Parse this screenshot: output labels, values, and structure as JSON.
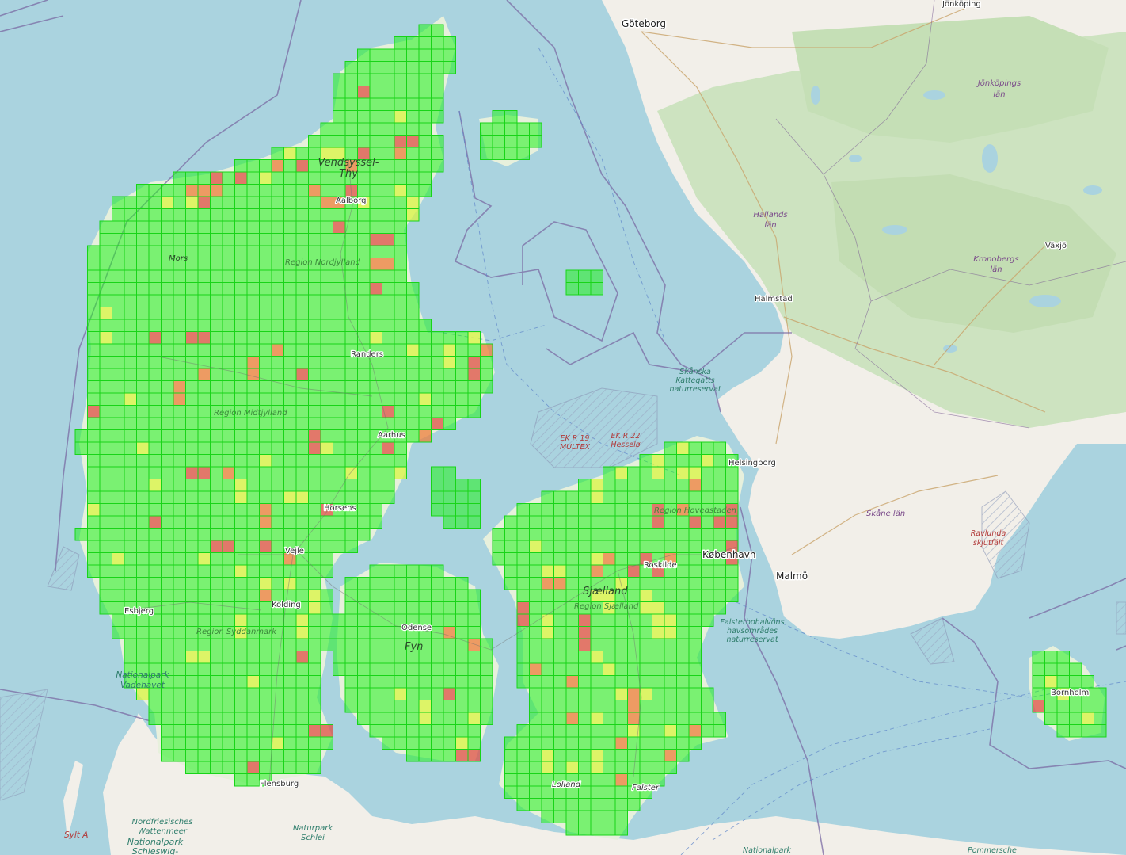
{
  "map": {
    "grid_colors": {
      "low": "#21f21b",
      "medium": "#d9f53a",
      "high": "#f07a35",
      "very_high": "#e04a3e",
      "grid_line": "#18d418"
    },
    "base_colors": {
      "sea": "#aad3df",
      "land": "#f2efe9",
      "forest": "#cde3c0",
      "border": "#7a5b93"
    }
  },
  "labels": {
    "goteborg": "Göteborg",
    "jonkoping": "Jönköping",
    "jonkopings_lan": "Jönköpings län",
    "hallands_lan": "Hallands län",
    "kronobergs_lan": "Kronobergs län",
    "vaxjo": "Växjö",
    "halmstad": "Halmstad",
    "skanska_kattegatts": "Skånska Kattegatts naturreservat",
    "ek_r19": "EK R 19 MULTEX",
    "ek_r22": "EK R 22 Hesselø",
    "helsingborg": "Helsingborg",
    "region_hovedstaden": "Region Hovedstaden",
    "kobenhavn": "København",
    "malmo": "Malmö",
    "skane_lan": "Skåne län",
    "ravlunda": "Ravlunda skjutfält",
    "falsterbohalvons": "Falsterbohalvöns havsområdes naturreservat",
    "bornholm": "Bornholm",
    "vendsyssel": "Vendsyssel-Thy",
    "aalborg": "Aalborg",
    "mors": "Mors",
    "region_nordjylland": "Region Nordjylland",
    "randers": "Randers",
    "region_midtjylland": "Region Midtjylland",
    "aarhus": "Aarhus",
    "horsens": "Horsens",
    "vejle": "Vejle",
    "kolding": "Kolding",
    "esbjerg": "Esbjerg",
    "region_syddanmark": "Region Syddanmark",
    "nationalpark_vadehavet": "Nationalpark Vadehavet",
    "odense": "Odense",
    "fyn": "Fyn",
    "sjaelland": "Sjælland",
    "region_sjaelland": "Region Sjælland",
    "roskilde": "Roskilde",
    "lolland": "Lolland",
    "falster": "Falster",
    "flensburg": "Flensburg",
    "nordfriesisches": "Nordfriesisches Wattenmeer",
    "nationalpark_schleswig": "Nationalpark Schleswig-",
    "naturpark_schlei": "Naturpark Schlei",
    "sylt": "Sylt A",
    "nationalpark_bottom": "Nationalpark",
    "pommersche": "Pommersche"
  }
}
